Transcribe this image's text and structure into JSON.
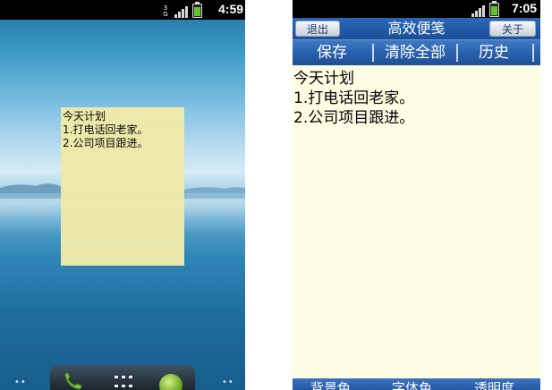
{
  "left_screen": {
    "status": {
      "network": "3G",
      "time": "4:59"
    },
    "note_widget": {
      "lines": [
        "今天计划",
        "1.打电话回老家。",
        "2.公司项目跟进。"
      ]
    },
    "dots_left": "••",
    "dots_right": "••",
    "dock": {
      "icons": [
        "phone-icon",
        "app-grid-icon",
        "browser-icon"
      ]
    }
  },
  "right_screen": {
    "status": {
      "time": "7:05"
    },
    "titlebar": {
      "exit_label": "退出",
      "title": "高效便笺",
      "about_label": "关于"
    },
    "toolbar": {
      "save_label": "保存",
      "clear_all_label": "清除全部",
      "history_label": "历史"
    },
    "editor": {
      "lines": [
        "今天计划",
        "1.打电话回老家。",
        "2.公司项目跟进。"
      ]
    },
    "bottombar": {
      "items": [
        "背景色",
        "字体色",
        "透明度"
      ]
    }
  },
  "colors": {
    "note_yellow": "#f0eaa8",
    "editor_bg": "#fdfde3",
    "bar_blue": "#2a61ad",
    "battery_green": "#5ec62b"
  }
}
